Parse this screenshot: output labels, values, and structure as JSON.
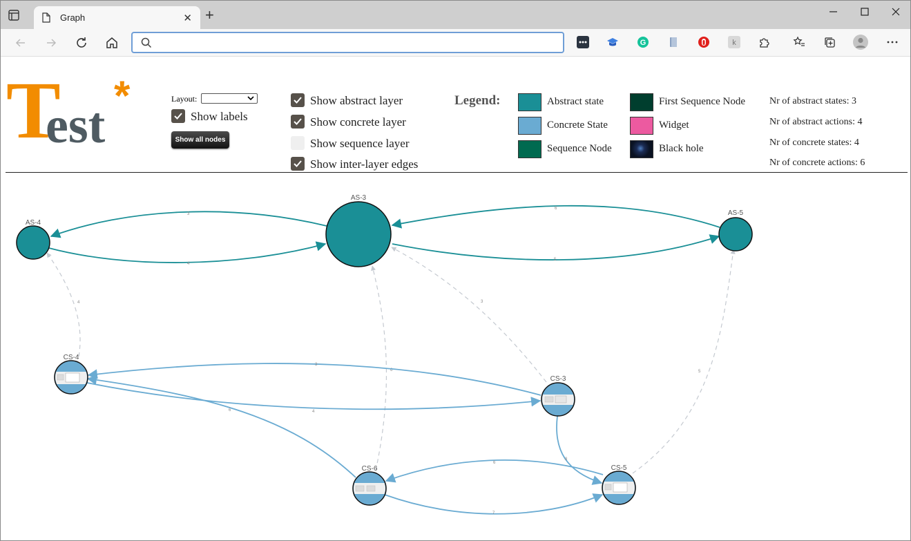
{
  "browser": {
    "tab_title": "Graph",
    "address_value": "",
    "colors": {
      "accent": "#6f9ed6"
    }
  },
  "controls": {
    "layout_label": "Layout:",
    "layout_value": "",
    "show_labels": {
      "label": "Show labels",
      "checked": true
    },
    "show_all_button": "Show all nodes",
    "layers": [
      {
        "label": "Show abstract layer",
        "checked": true
      },
      {
        "label": "Show concrete layer",
        "checked": true
      },
      {
        "label": "Show sequence layer",
        "checked": false
      },
      {
        "label": "Show inter-layer edges",
        "checked": true
      }
    ]
  },
  "legend": {
    "title": "Legend:",
    "items": [
      {
        "label": "Abstract state",
        "color": "#1a8f96"
      },
      {
        "label": "Concrete State",
        "color": "#6aabd2"
      },
      {
        "label": "Sequence Node",
        "color": "#006a50"
      },
      {
        "label": "First Sequence Node",
        "color": "#003e2e"
      },
      {
        "label": "Widget",
        "color": "#ec5aa0"
      },
      {
        "label": "Black hole",
        "color": "#0a1222"
      }
    ]
  },
  "stats": [
    "Nr of abstract states: 3",
    "Nr of abstract actions: 4",
    "Nr of concrete states: 4",
    "Nr of concrete actions: 6"
  ],
  "graph": {
    "colors": {
      "abstract": "#1a8f96",
      "concrete": "#6aabd2",
      "inter_layer": "#c4c9d0"
    },
    "nodes": [
      {
        "id": "AS-4",
        "label": "AS-4",
        "type": "abstract"
      },
      {
        "id": "AS-3",
        "label": "AS-3",
        "type": "abstract"
      },
      {
        "id": "AS-5",
        "label": "AS-5",
        "type": "abstract"
      },
      {
        "id": "CS-4",
        "label": "CS-4",
        "type": "concrete"
      },
      {
        "id": "CS-3",
        "label": "CS-3",
        "type": "concrete"
      },
      {
        "id": "CS-6",
        "label": "CS-6",
        "type": "concrete"
      },
      {
        "id": "CS-5",
        "label": "CS-5",
        "type": "concrete"
      }
    ],
    "edge_labels": {
      "as3_as4": "3",
      "as4_as3": "4",
      "as5_as3": "6",
      "as3_as5": "5",
      "cs3_cs4": "3",
      "cs4_cs3": "4",
      "cs6_cs4": "6",
      "cs3_cs5": "8",
      "cs5_cs6": "6",
      "cs6_cs5": "7",
      "cs4_as4": "4",
      "cs6_as3": "6",
      "cs3_as3": "3",
      "cs5_as5": "5"
    }
  }
}
